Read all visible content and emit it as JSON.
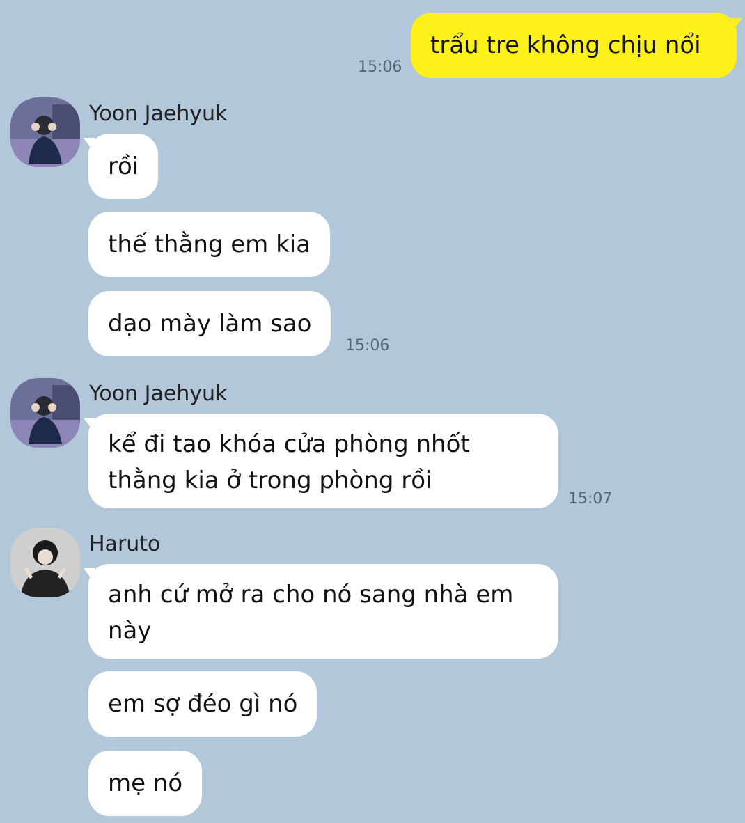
{
  "colors": {
    "background": "#b2c7da",
    "my_bubble": "#fef01b",
    "their_bubble": "#ffffff"
  },
  "chat": {
    "outgoing": {
      "text": "trẩu tre không chịu nổi",
      "time": "15:06"
    },
    "groups": [
      {
        "sender": "Yoon Jaehyuk",
        "avatar_icon": "user-avatar-photo",
        "messages": [
          "rồi",
          "thế thằng em kia",
          "dạo mày làm sao"
        ],
        "time": "15:06"
      },
      {
        "sender": "Yoon Jaehyuk",
        "avatar_icon": "user-avatar-photo",
        "messages": [
          "kể đi tao khóa cửa phòng nhốt thằng kia ở trong phòng rồi"
        ],
        "time": "15:07"
      },
      {
        "sender": "Haruto",
        "avatar_icon": "user-avatar-photo",
        "messages": [
          "anh cứ mở ra cho nó sang nhà em này",
          "em sợ đéo gì nó",
          "mẹ nó"
        ],
        "time": ""
      }
    ]
  }
}
